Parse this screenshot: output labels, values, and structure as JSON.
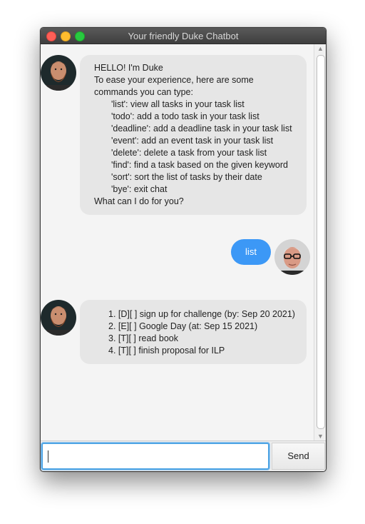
{
  "window": {
    "title": "Your friendly Duke Chatbot"
  },
  "colors": {
    "user_bubble": "#3c98f6",
    "bot_bubble": "#e6e6e6",
    "input_focus": "#4ea4e4"
  },
  "messages": [
    {
      "sender": "bot",
      "avatar": "bearded-man-avatar",
      "lines": [
        "HELLO! I'm Duke",
        "To ease your experience, here are some",
        "commands you can type:",
        "'list': view all tasks in your task list",
        "'todo': add a todo task in your task list",
        "'deadline': add a deadline task in your task list",
        "'event': add an event task in your task list",
        "'delete': delete a task from your task list",
        "'find': find a task based on the given keyword",
        "'sort': sort the list of tasks by their date",
        "'bye': exit chat",
        "What can I do for you?"
      ]
    },
    {
      "sender": "user",
      "avatar": "man-with-glasses-avatar",
      "text": "list"
    },
    {
      "sender": "bot",
      "avatar": "bearded-man-avatar",
      "lines": [
        "1. [D][ ] sign up for challenge (by: Sep 20 2021)",
        "2. [E][ ] Google Day (at: Sep 15 2021)",
        "3. [T][ ] read book",
        "4. [T][ ] finish proposal for ILP"
      ]
    }
  ],
  "input": {
    "value": "",
    "placeholder": ""
  },
  "send_button": {
    "label": "Send"
  }
}
